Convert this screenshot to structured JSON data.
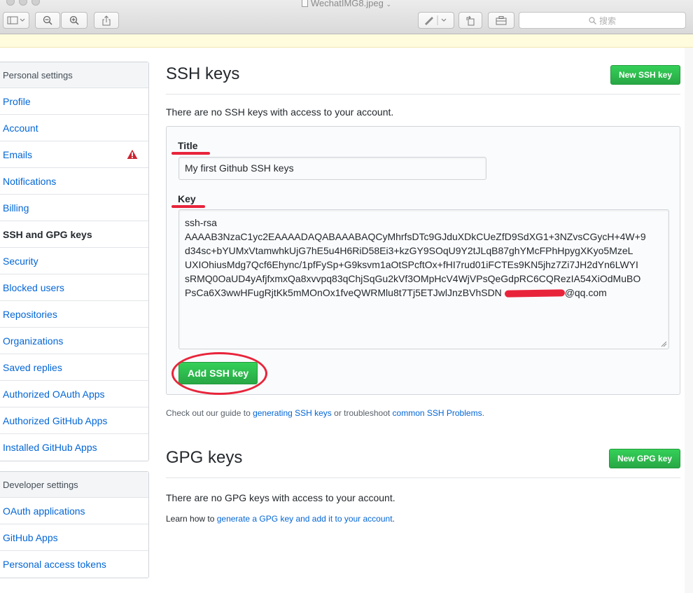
{
  "window": {
    "filename": "WechatIMG8.jpeg",
    "search_placeholder": "搜索"
  },
  "sidebar": {
    "personal_heading": "Personal settings",
    "personal_items": [
      {
        "label": "Profile"
      },
      {
        "label": "Account"
      },
      {
        "label": "Emails"
      },
      {
        "label": "Notifications"
      },
      {
        "label": "Billing"
      },
      {
        "label": "SSH and GPG keys"
      },
      {
        "label": "Security"
      },
      {
        "label": "Blocked users"
      },
      {
        "label": "Repositories"
      },
      {
        "label": "Organizations"
      },
      {
        "label": "Saved replies"
      },
      {
        "label": "Authorized OAuth Apps"
      },
      {
        "label": "Authorized GitHub Apps"
      },
      {
        "label": "Installed GitHub Apps"
      }
    ],
    "developer_heading": "Developer settings",
    "developer_items": [
      {
        "label": "OAuth applications"
      },
      {
        "label": "GitHub Apps"
      },
      {
        "label": "Personal access tokens"
      }
    ]
  },
  "ssh": {
    "heading": "SSH keys",
    "new_button": "New SSH key",
    "empty": "There are no SSH keys with access to your account.",
    "title_label": "Title",
    "title_value": "My first Github SSH keys",
    "key_label": "Key",
    "key_lines": [
      "ssh-rsa",
      "AAAAB3NzaC1yc2EAAAADAQABAAABAQCyMhrfsDTc9GJduXDkCUeZfD9SdXG1+3NZvsCGycH+4W+9",
      "d34sc+bYUMxVtamwhkUjG7hE5u4H6RiD58Ei3+kzGY9SOqU9Y2tJLqB87ghYMcFPhHpygXKyo5MzeL",
      "UXIOhiusMdg7Qcf6Ehync/1pfFySp+G9ksvm1aOtSPcftOx+fHI7rud01iFCTEs9KN5jhz7Zi7JH2dYn6LWYI",
      "sRMQ0OaUD4yAfjfxmxQa8xvvpq83qChjSqGu2kVf3OMpHcV4WjVPsQeGdpRC6CQRezIA54XiOdMuBO"
    ],
    "key_last_prefix": "PsCa6X3wwHFugRjtKk5mMOnOx1fveQWRMlu8t7Tj5ETJwlJnzBVhSDN ",
    "key_last_suffix": "@qq.com",
    "add_button": "Add SSH key",
    "help_prefix": "Check out our guide to ",
    "help_link1": "generating SSH keys",
    "help_middle": " or troubleshoot ",
    "help_link2": "common SSH Problems",
    "help_suffix": "."
  },
  "gpg": {
    "heading": "GPG keys",
    "new_button": "New GPG key",
    "empty": "There are no GPG keys with access to your account.",
    "learn_prefix": "Learn how to ",
    "learn_link": "generate a GPG key and add it to your account",
    "learn_suffix": "."
  },
  "colors": {
    "link": "#0366d6",
    "green": "#28a745",
    "annotation_red": "#e8243b",
    "warning": "#cb2431"
  }
}
